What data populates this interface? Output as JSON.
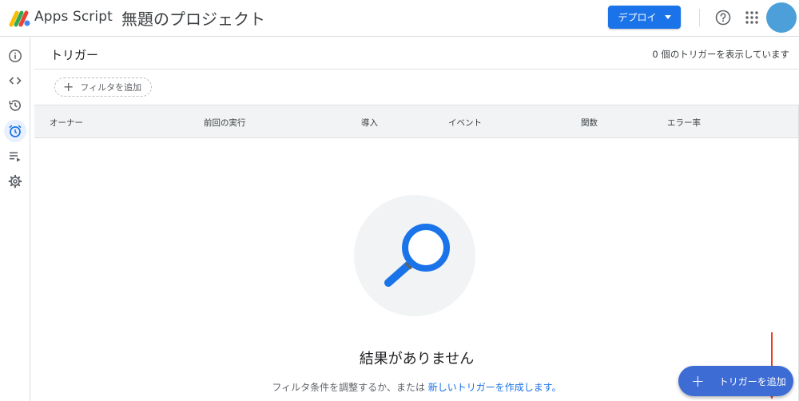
{
  "header": {
    "app_name": "Apps Script",
    "project_title": "無題のプロジェクト",
    "deploy_label": "デプロイ"
  },
  "rail": {
    "items": [
      {
        "icon": "info-icon"
      },
      {
        "icon": "code-icon"
      },
      {
        "icon": "history-icon"
      },
      {
        "icon": "alarm-clock-icon",
        "active": true
      },
      {
        "icon": "playlist-play-icon"
      },
      {
        "icon": "gear-icon"
      }
    ]
  },
  "main": {
    "title": "トリガー",
    "count_text": "0 個のトリガーを表示しています",
    "filter_label": "フィルタを追加",
    "columns": [
      "オーナー",
      "前回の実行",
      "導入",
      "イベント",
      "関数",
      "エラー率"
    ],
    "empty_title": "結果がありません",
    "empty_hint_prefix": "フィルタ条件を調整するか、または ",
    "empty_hint_link": "新しいトリガーを作成します。",
    "fab_label": "トリガーを追加"
  },
  "colors": {
    "accent": "#1a73e8",
    "fab": "#3c6cd4",
    "annotation_arrow": "#e8401c",
    "avatar": "#4c9fd9"
  }
}
